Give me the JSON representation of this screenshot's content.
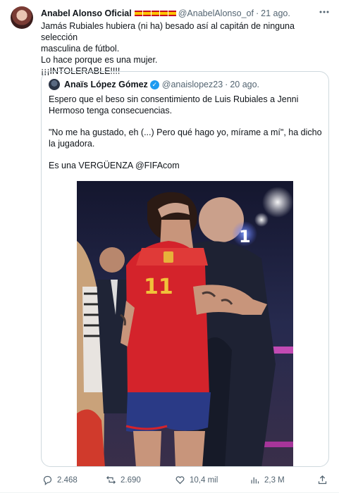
{
  "tweet": {
    "author_name": "Anabel Alonso Oficial",
    "flags_count": 5,
    "handle": "@AnabelAlonso_of",
    "separator": "·",
    "time": "21 ago.",
    "more_icon": "more-icon",
    "lines": [
      "Jamás Rubiales hubiera (ni ha) besado así al capitán de ninguna selección",
      "masculina de fútbol.",
      "Lo hace porque es una mujer.",
      "¡¡¡INTOLERABLE!!!!"
    ]
  },
  "quote": {
    "author_name": "Anaïs López Gómez",
    "verified_icon": "verified-badge-icon",
    "handle": "@anaislopez23",
    "separator": "·",
    "time": "20 ago.",
    "paragraphs": [
      "Espero que el beso sin consentimiento de Luis Rubiales a Jenni Hermoso tenga consecuencias.",
      "\"No me ha gustado, eh (...) Pero qué hago yo, mírame a mí\", ha dicho la jugadora.",
      "Es una VERGÜENZA @FIFAcom"
    ],
    "media": {
      "jersey_number": "11",
      "overlay_number": "1"
    }
  },
  "actions": {
    "reply": {
      "icon": "reply-icon",
      "count": "2.468"
    },
    "retweet": {
      "icon": "retweet-icon",
      "count": "2.690"
    },
    "like": {
      "icon": "like-icon",
      "count": "10,4 mil"
    },
    "views": {
      "icon": "views-icon",
      "count": "2,3 M"
    },
    "share": {
      "icon": "share-icon"
    }
  },
  "colors": {
    "accent": "#1d9bf0",
    "text_secondary": "#536471",
    "border": "#cfd9de"
  }
}
